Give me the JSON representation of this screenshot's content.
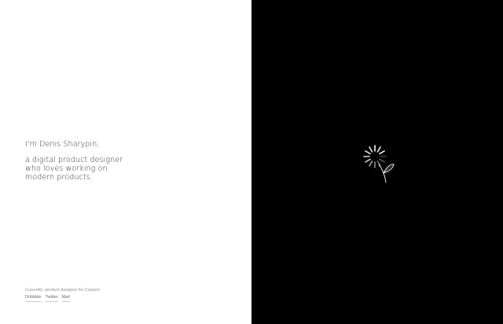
{
  "intro": {
    "greeting": "I'm Denis Sharypin,",
    "description_lines": [
      "a digital product designer",
      "who loves working on",
      "modern products."
    ]
  },
  "footer": {
    "current": "Currently: product designer for Corazio",
    "links": [
      {
        "label": "Dribbble"
      },
      {
        "label": "Twitter"
      },
      {
        "label": "Mail"
      }
    ]
  },
  "colors": {
    "left_background": "#ffffff",
    "right_background": "#000000",
    "text": "#2d2d2d",
    "muted_text": "#8e8e8e",
    "illustration": "#ffffff"
  },
  "illustration": {
    "icon": "flower-loader-icon"
  }
}
